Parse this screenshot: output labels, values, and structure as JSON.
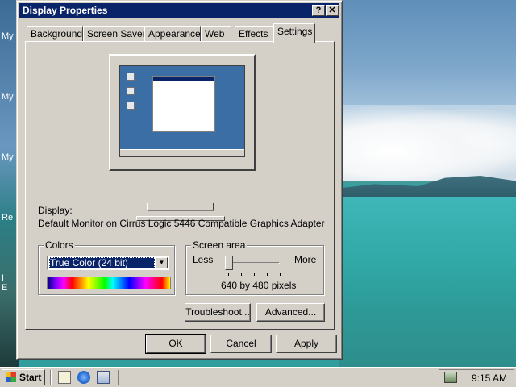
{
  "desktop": {
    "icon_labels": [
      "My D",
      "My",
      "My",
      "Re",
      "I",
      "E"
    ]
  },
  "window": {
    "title": "Display Properties",
    "help_button": "?",
    "close_button": "✕",
    "tabs": [
      {
        "label": "Background"
      },
      {
        "label": "Screen Saver"
      },
      {
        "label": "Appearance"
      },
      {
        "label": "Web"
      },
      {
        "label": "Effects"
      },
      {
        "label": "Settings"
      }
    ],
    "active_tab": "Settings",
    "display_label": "Display:",
    "display_value": "Default Monitor on Cirrus Logic 5446 Compatible Graphics Adapter",
    "colors": {
      "group_title": "Colors",
      "selected": "True Color (24 bit)"
    },
    "screen_area": {
      "group_title": "Screen area",
      "less_label": "Less",
      "more_label": "More",
      "resolution_text": "640 by 480 pixels",
      "slider_position_fraction": 0.0
    },
    "buttons": {
      "troubleshoot": "Troubleshoot...",
      "advanced": "Advanced...",
      "ok": "OK",
      "cancel": "Cancel",
      "apply": "Apply"
    }
  },
  "taskbar": {
    "start_label": "Start",
    "quick_launch_icons": [
      "show-desktop-icon",
      "internet-explorer-icon",
      "outlook-express-icon"
    ],
    "clock": "9:15 AM",
    "tray_icons": [
      "display-settings-tray-icon"
    ]
  }
}
